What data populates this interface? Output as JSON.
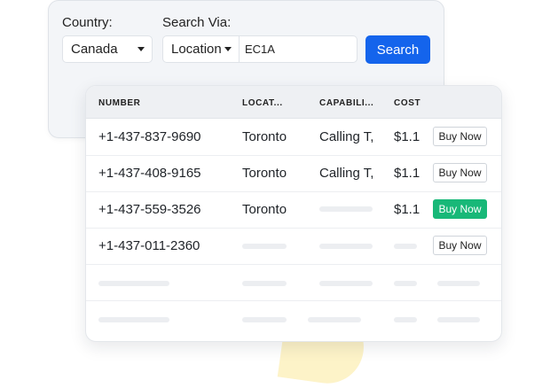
{
  "search": {
    "country_label": "Country:",
    "country_value": "Canada",
    "via_label": "Search Via:",
    "via_value": "Location",
    "query_value": "EC1A",
    "search_button": "Search"
  },
  "table": {
    "headers": [
      "NUMBER",
      "LOCAT...",
      "CAPABILI...",
      "COST"
    ],
    "rows": [
      {
        "number": "+1-437-837-9690",
        "location": "Toronto",
        "capability": "Calling T,",
        "cost": "$1.1",
        "action": "Buy Now"
      },
      {
        "number": "+1-437-408-9165",
        "location": "Toronto",
        "capability": "Calling T,",
        "cost": "$1.1",
        "action": "Buy Now"
      },
      {
        "number": "+1-437-559-3526",
        "location": "Toronto",
        "capability": "",
        "cost": "$1.1",
        "action": "Buy Now"
      },
      {
        "number": "+1-437-011-2360",
        "location": "",
        "capability": "",
        "cost": "",
        "action": "Buy Now"
      }
    ]
  },
  "colors": {
    "primary": "#1464ec",
    "buy_active": "#18b878"
  },
  "icons": [
    "chevron-down-icon"
  ]
}
